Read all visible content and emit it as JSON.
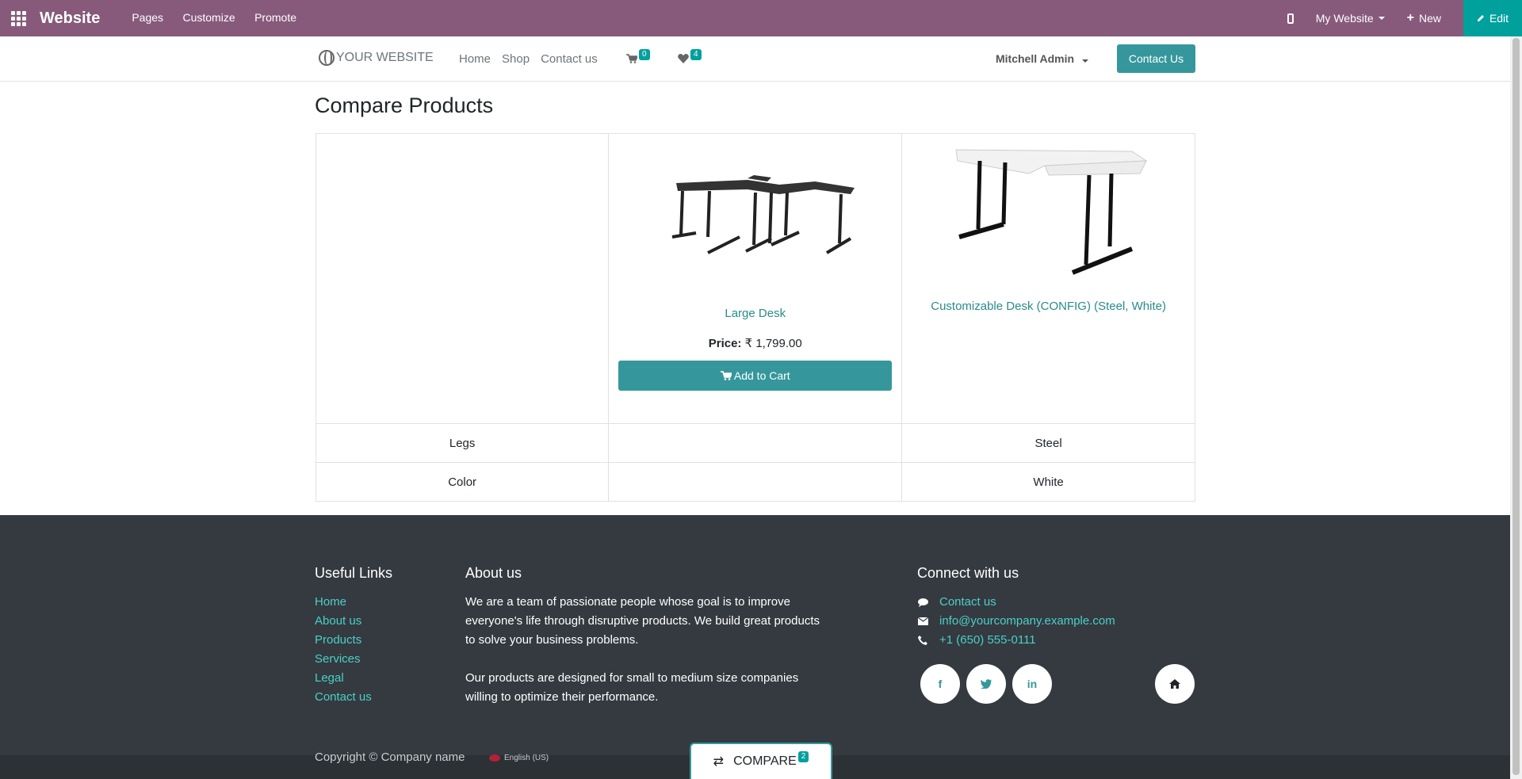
{
  "admin_bar": {
    "title": "Website",
    "menu": [
      "Pages",
      "Customize",
      "Promote"
    ],
    "website_selector": "My Website",
    "new_label": "New",
    "edit_label": "Edit",
    "color": "#875a7b",
    "edit_color": "#00a09d"
  },
  "site_header": {
    "logo_text": "YOUR WEBSITE",
    "nav": [
      "Home",
      "Shop",
      "Contact us"
    ],
    "cart_count": "0",
    "wishlist_count": "4",
    "user_name": "Mitchell Admin",
    "contact_button": "Contact Us",
    "accent": "#35979c"
  },
  "main": {
    "title": "Compare Products",
    "products": [
      {
        "name": "Large Desk",
        "price_label": "Price:",
        "price": "₹ 1,799.00",
        "add_to_cart": "Add to Cart"
      },
      {
        "name": "Customizable Desk (CONFIG) (Steel, White)"
      }
    ],
    "attributes": [
      {
        "name": "Legs",
        "values": [
          "",
          "Steel"
        ]
      },
      {
        "name": "Color",
        "values": [
          "",
          "White"
        ]
      }
    ]
  },
  "footer": {
    "useful_links_title": "Useful Links",
    "useful_links": [
      "Home",
      "About us",
      "Products",
      "Services",
      "Legal",
      "Contact us"
    ],
    "about_title": "About us",
    "about_p1": "We are a team of passionate people whose goal is to improve everyone's life through disruptive products. We build great products to solve your business problems.",
    "about_p2": "Our products are designed for small to medium size companies willing to optimize their performance.",
    "connect_title": "Connect with us",
    "contact_link": "Contact us",
    "email": "info@yourcompany.example.com",
    "phone": "+1 (650) 555-0111",
    "socials": [
      "facebook-icon",
      "twitter-icon",
      "linkedin-icon",
      "home-icon"
    ],
    "copyright": "Copyright © Company name",
    "language": "English (US)"
  },
  "compare_tab": {
    "label": "COMPARE",
    "count": "2"
  }
}
